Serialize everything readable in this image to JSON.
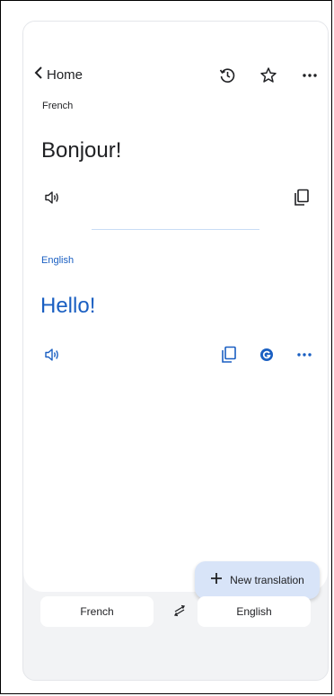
{
  "header": {
    "back_label": "Home"
  },
  "icons": {
    "back": "chevron-left-icon",
    "history": "history-icon",
    "favorite": "star-icon",
    "more": "more-horizontal-icon",
    "speaker": "speaker-icon",
    "copy": "copy-icon",
    "google": "google-icon",
    "add": "plus-icon",
    "swap": "swap-arrows-icon"
  },
  "source": {
    "language": "French",
    "text": "Bonjour!"
  },
  "target": {
    "language": "English",
    "text": "Hello!"
  },
  "fab": {
    "label": "New translation"
  },
  "language_bar": {
    "source": "French",
    "target": "English"
  },
  "colors": {
    "accent": "#1a5fc2",
    "fab_bg": "#d8e4f8",
    "divider": "#c8dcf5"
  }
}
